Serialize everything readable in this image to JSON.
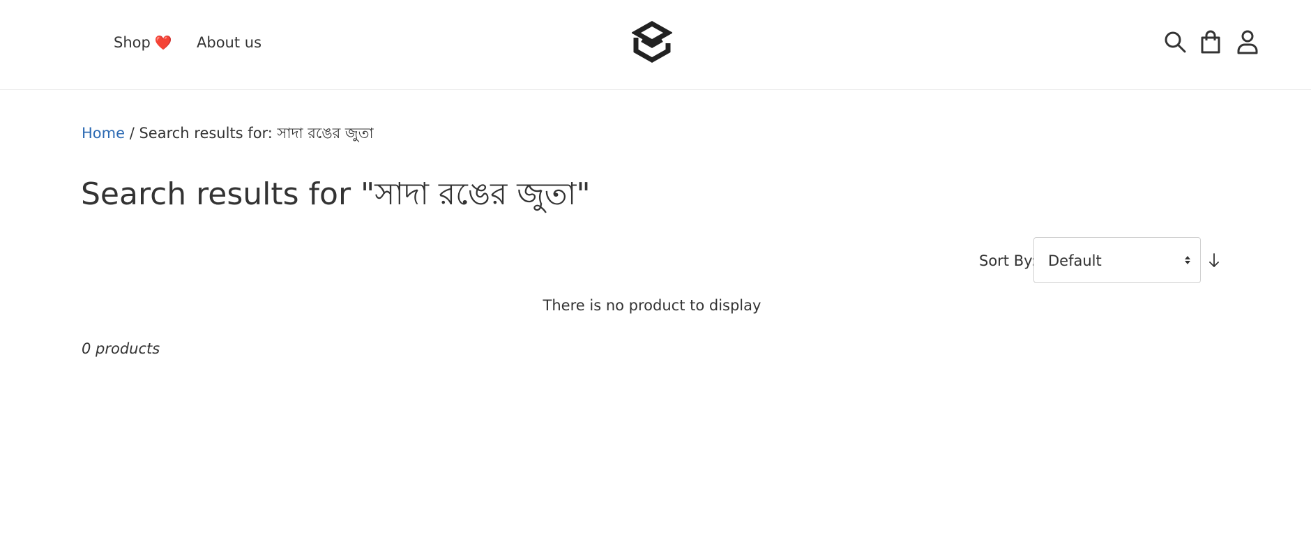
{
  "header": {
    "nav": {
      "shop_label": "Shop",
      "shop_emoji": "❤️",
      "about_label": "About us"
    },
    "logo_icon": "layered-stack-hexagon-logo",
    "icons": [
      "search-icon",
      "shopping-bag-icon",
      "user-icon"
    ]
  },
  "breadcrumb": {
    "home_label": "Home",
    "separator": " / ",
    "current": "Search results for: সাদা রঙের জুতা"
  },
  "main": {
    "title": "Search results for \"সাদা রঙের জুতা\"",
    "sort": {
      "label": "Sort By:",
      "selected": "Default",
      "direction_icon": "arrow-down-icon"
    },
    "empty_message": "There is no product to display",
    "product_count": "0 products"
  },
  "colors": {
    "link": "#2c6ab3",
    "text": "#333333",
    "heart": "#ef2b3a",
    "border": "#cfcfcf"
  }
}
